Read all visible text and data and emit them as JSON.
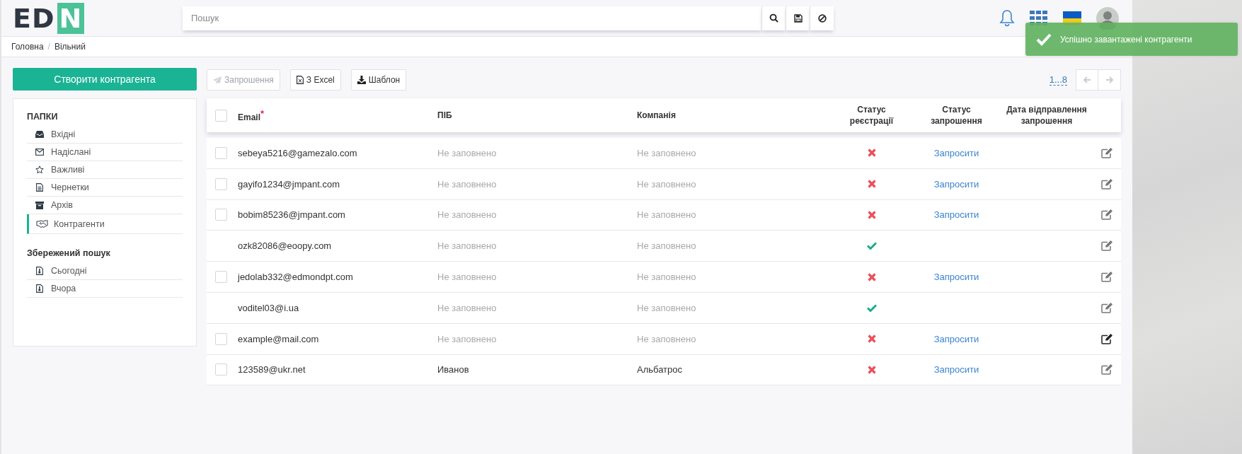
{
  "header": {
    "logo": {
      "dark": "ED",
      "accent": "N"
    },
    "search": {
      "placeholder": "Пошук"
    },
    "search_buttons": [
      {
        "kind": "search"
      },
      {
        "kind": "save"
      },
      {
        "kind": "clear"
      }
    ],
    "icons": [
      {
        "kind": "bell"
      },
      {
        "kind": "apps"
      },
      {
        "kind": "flag"
      },
      {
        "kind": "avatar"
      }
    ]
  },
  "breadcrumbs": {
    "items": [
      "Головна",
      "Вільний"
    ],
    "separator": "/"
  },
  "toast": {
    "text": "Успішно завантажені контрагенти"
  },
  "create_button": "Створити контрагента",
  "sidebar": {
    "sections": [
      {
        "title": "ПАПКИ",
        "items": [
          {
            "label": "Вхідні",
            "kind": "inbox",
            "selected": false
          },
          {
            "label": "Надіслані",
            "kind": "envelope",
            "selected": false
          },
          {
            "label": "Важливі",
            "kind": "star",
            "selected": false
          },
          {
            "label": "Чернетки",
            "kind": "document",
            "selected": false
          },
          {
            "label": "Архів",
            "kind": "archive",
            "selected": false
          },
          {
            "label": "Контрагенти",
            "kind": "handshake",
            "selected": true
          }
        ]
      },
      {
        "title": "Збережений пошук",
        "items": [
          {
            "label": "Сьогодні",
            "kind": "saved",
            "selected": false
          },
          {
            "label": "Вчора",
            "kind": "saved",
            "selected": false
          }
        ]
      }
    ]
  },
  "toolbar": [
    {
      "label": "Запрошення",
      "kind": "plane",
      "disabled": true
    },
    {
      "label": "З Excel",
      "kind": "excel",
      "disabled": false
    },
    {
      "label": "Шаблон",
      "kind": "download",
      "disabled": false
    }
  ],
  "pagination": {
    "pages": "1...8",
    "prev_disabled": true,
    "next_disabled": true
  },
  "table": {
    "select_all": {
      "checked": false
    },
    "columns": [
      {
        "label": "Email",
        "required_mark": "*"
      },
      {
        "label": "ПІБ"
      },
      {
        "label": "Компанія"
      },
      {
        "label": "Статус реєстрації"
      },
      {
        "label": "Статус запрошення"
      },
      {
        "label": "Дата відправлення запрошення"
      }
    ],
    "rows": [
      {
        "checkbox": {
          "checked": false
        },
        "email": "sebeya5216@gamezalo.com",
        "name": {
          "text": "Не заповнено",
          "empty": true
        },
        "company": {
          "text": "Не заповнено",
          "empty": true
        },
        "registered": false,
        "invite": "Запросити",
        "edit_highlighted": false
      },
      {
        "checkbox": {
          "checked": false
        },
        "email": "gayifo1234@jmpant.com",
        "name": {
          "text": "Не заповнено",
          "empty": true
        },
        "company": {
          "text": "Не заповнено",
          "empty": true
        },
        "registered": false,
        "invite": "Запросити",
        "edit_highlighted": false
      },
      {
        "checkbox": {
          "checked": false
        },
        "email": "bobim85236@jmpant.com",
        "name": {
          "text": "Не заповнено",
          "empty": true
        },
        "company": {
          "text": "Не заповнено",
          "empty": true
        },
        "registered": false,
        "invite": "Запросити",
        "edit_highlighted": false
      },
      {
        "email": "ozk82086@eoopy.com",
        "name": {
          "text": "Не заповнено",
          "empty": true
        },
        "company": {
          "text": "Не заповнено",
          "empty": true
        },
        "registered": true,
        "edit_highlighted": false
      },
      {
        "checkbox": {
          "checked": false
        },
        "email": "jedolab332@edmondpt.com",
        "name": {
          "text": "Не заповнено",
          "empty": true
        },
        "company": {
          "text": "Не заповнено",
          "empty": true
        },
        "registered": false,
        "invite": "Запросити",
        "edit_highlighted": false
      },
      {
        "email": "voditel03@i.ua",
        "name": {
          "text": "Не заповнено",
          "empty": true
        },
        "company": {
          "text": "Не заповнено",
          "empty": true
        },
        "registered": true,
        "edit_highlighted": false
      },
      {
        "checkbox": {
          "checked": false
        },
        "email": "example@mail.com",
        "name": {
          "text": "Не заповнено",
          "empty": true
        },
        "company": {
          "text": "Не заповнено",
          "empty": true
        },
        "registered": false,
        "invite": "Запросити",
        "edit_highlighted": true
      },
      {
        "checkbox": {
          "checked": false
        },
        "email": "123589@ukr.net",
        "name": {
          "text": "Иванов",
          "empty": false
        },
        "company": {
          "text": "Альбатрос",
          "empty": false
        },
        "registered": false,
        "invite": "Запросити",
        "edit_highlighted": false
      }
    ]
  }
}
